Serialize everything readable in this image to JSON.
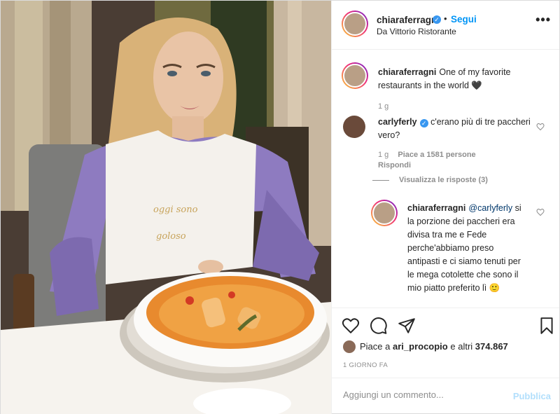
{
  "post": {
    "username": "chiaraferragni",
    "follow_label": "Segui",
    "separator": "•",
    "location": "Da Vittorio Ristorante",
    "more_label": "•••",
    "verified_mark": "✓"
  },
  "caption": {
    "username": "chiaraferragni",
    "text": "One of my favorite restaurants in the world",
    "emoji": "🖤",
    "time": "1 g"
  },
  "comments": [
    {
      "username": "carlyferly",
      "text": "c'erano più di tre paccheri vero?",
      "time": "1 g",
      "likes": "Piace a 1581 persone",
      "reply_label": "Rispondi",
      "view_replies": "Visualizza le risposte (3)"
    }
  ],
  "reply": {
    "username": "chiaraferragni",
    "mention": "@carlyferly",
    "text": "si la porzione dei paccheri era divisa tra me e Fede perche'abbiamo preso antipasti e ci siamo tenuti per le mega cotolette che sono il mio piatto preferito lì 🙂"
  },
  "actions": {
    "icons": [
      "heart-icon",
      "comment-icon",
      "share-icon",
      "bookmark-icon"
    ],
    "likes_prefix": "Piace a",
    "likes_user": "ari_procopio",
    "likes_suffix": "e altri",
    "likes_count": "374.867",
    "date": "1 GIORNO FA"
  },
  "composer": {
    "placeholder": "Aggiungi un commento...",
    "publish_label": "Pubblica"
  },
  "photo": {
    "bib_text_line1": "oggi sono",
    "bib_text_line2": "goloso"
  },
  "colors": {
    "accent": "#0095f6",
    "verified": "#3897f0",
    "publish_disabled": "#b2dffc",
    "sweater": "#8e7bc0",
    "sauce": "#e88a2e"
  }
}
